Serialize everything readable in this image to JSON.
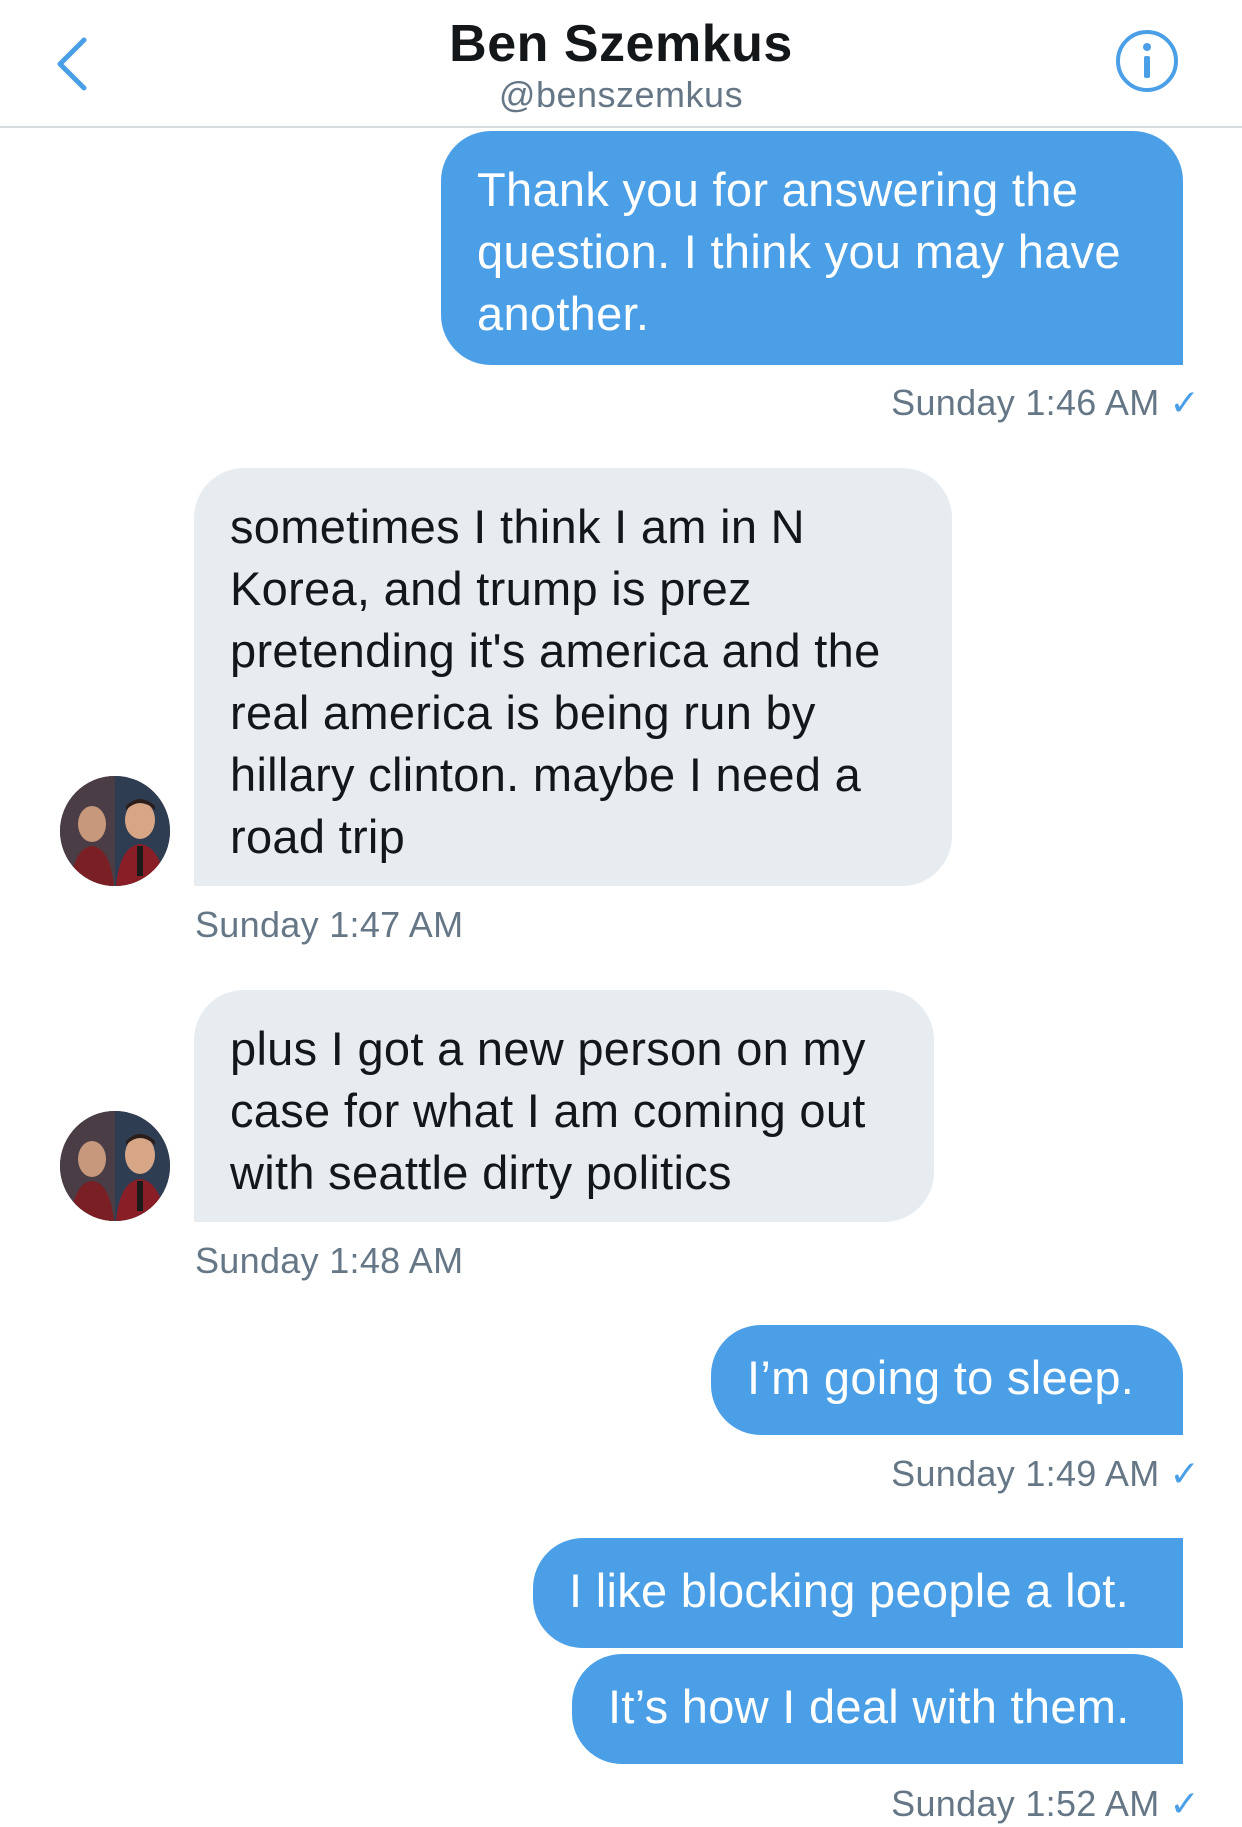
{
  "header": {
    "name": "Ben Szemkus",
    "handle": "@benszemkus"
  },
  "messages": [
    {
      "direction": "outgoing",
      "text": "Thank you for answering the question. I think you may have another."
    },
    {
      "direction": "incoming",
      "text": "sometimes I think I am in N Korea, and trump is prez pretending it's america and the real america is being run by hillary clinton.  maybe I need a road trip"
    },
    {
      "direction": "incoming",
      "text": "plus I got a new person on my case for what I am coming out with seattle dirty politics"
    },
    {
      "direction": "outgoing",
      "text": "I’m going to sleep."
    },
    {
      "direction": "outgoing",
      "text": "I like blocking people a lot."
    },
    {
      "direction": "outgoing",
      "text": "It’s how I deal with them."
    }
  ],
  "timestamps": {
    "t1": "Sunday 1:46 AM",
    "t2": "Sunday 1:47 AM",
    "t3": "Sunday 1:48 AM",
    "t4": "Sunday 1:49 AM",
    "t5": "Sunday 1:52 AM"
  },
  "read_receipt_glyph": "✓",
  "colors": {
    "outgoing_bubble": "#4b9fe6",
    "incoming_bubble": "#e6ecf0",
    "accent": "#4b9fe6",
    "secondary_text": "#657786"
  },
  "icons": {
    "back": "chevron-left-icon",
    "info": "info-circle-icon"
  }
}
